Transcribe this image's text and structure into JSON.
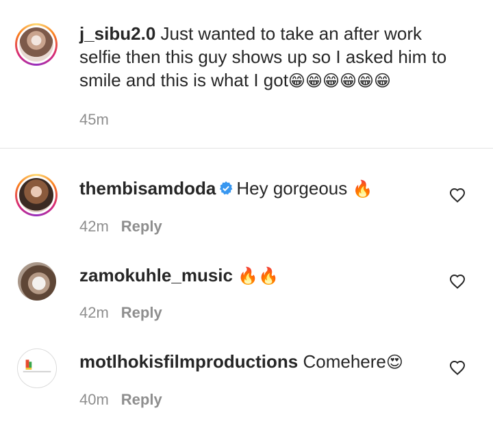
{
  "caption": {
    "username": "j_sibu2.0",
    "text_line1": " Just wanted to take an after work",
    "text_line2": "selfie then this guy shows up so I asked him to",
    "text_line3": "smile and this is what I got",
    "emojis": "😁😁😁😁😁😁",
    "time": "45m"
  },
  "comments": [
    {
      "username": "thembisamdoda",
      "verified": true,
      "text": "Hey gorgeous ",
      "emoji": "🔥",
      "time": "42m",
      "reply": "Reply"
    },
    {
      "username": "zamokuhle_music",
      "verified": false,
      "text": " ",
      "emoji": "🔥🔥",
      "time": "42m",
      "reply": "Reply"
    },
    {
      "username": "motlhokisfilmproductions",
      "verified": false,
      "text": " Comehere",
      "emoji": "😍",
      "time": "40m",
      "reply": "Reply"
    }
  ],
  "icons": {
    "heart": "heart-outline-icon",
    "verified": "verified-badge-icon"
  },
  "colors": {
    "verified_blue": "#3897f0",
    "meta_gray": "#8e8e8e",
    "text_dark": "#262626"
  }
}
